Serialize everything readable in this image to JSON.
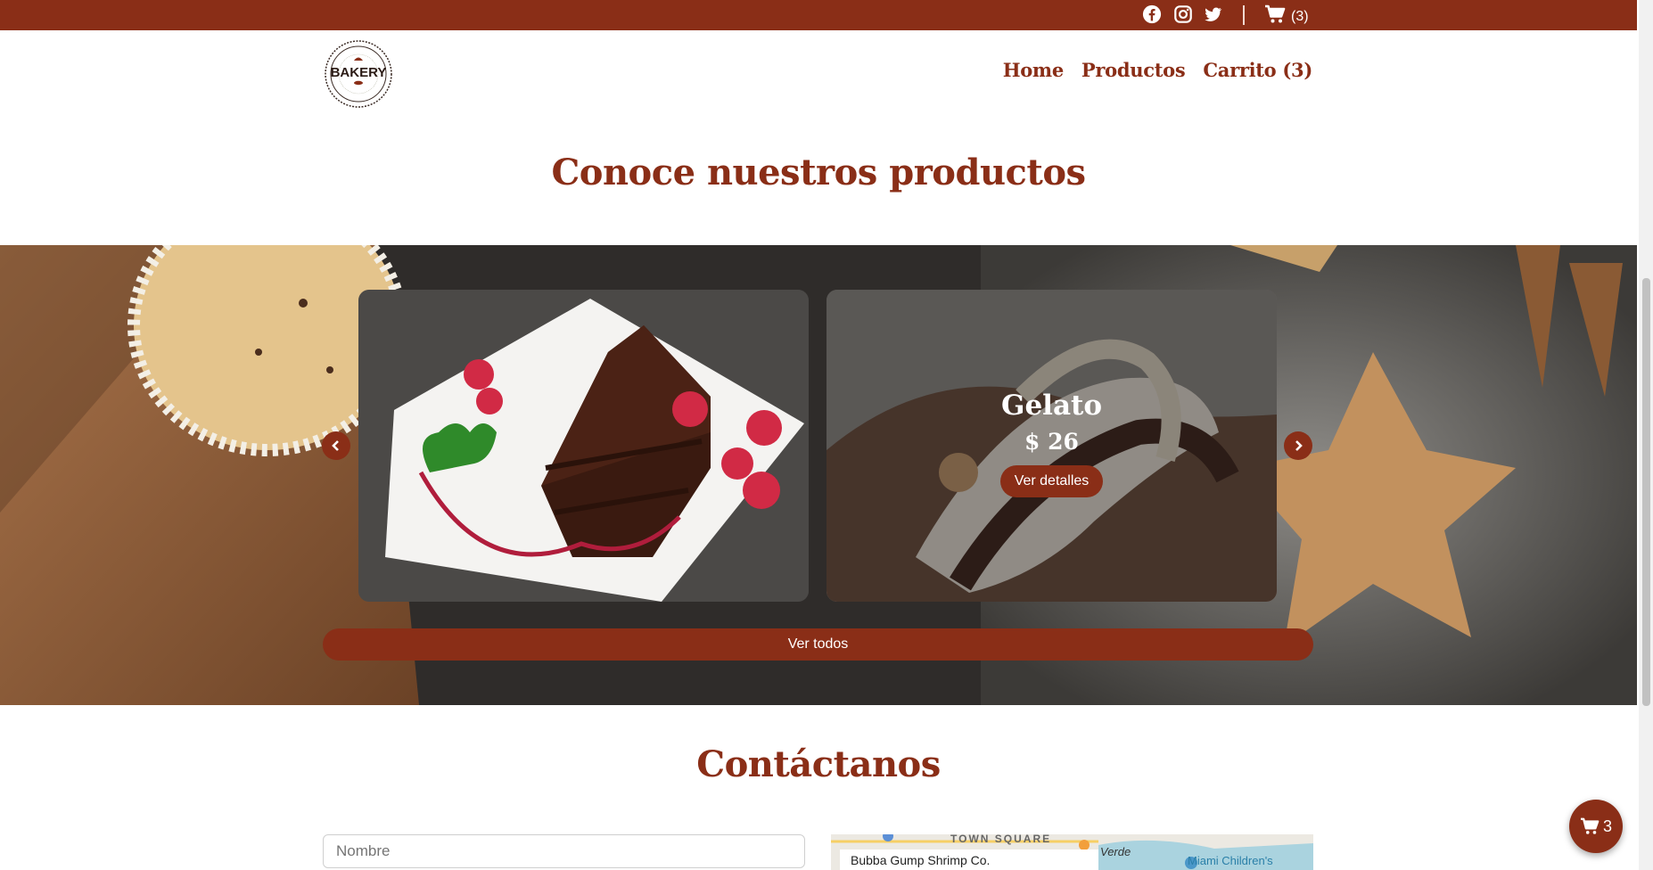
{
  "topbar": {
    "social_icons": [
      "facebook-icon",
      "instagram-icon",
      "twitter-icon"
    ],
    "cart_icon": "cart-icon",
    "cart_count": "(3)"
  },
  "header": {
    "logo_text": "BAKERY",
    "nav": [
      {
        "label": "Home"
      },
      {
        "label": "Productos"
      },
      {
        "label": "Carrito (3)"
      }
    ]
  },
  "products_section": {
    "title": "Conoce nuestros productos",
    "featured": {
      "name": "Gelato",
      "price": "$ 26",
      "details_button": "Ver detalles"
    },
    "view_all_button": "Ver todos"
  },
  "contact_section": {
    "title": "Contáctanos",
    "name_placeholder": "Nombre",
    "map": {
      "place_label": "Bubba Gump Shrimp Co.",
      "area_label": "TOWN SQUARE",
      "verde_label": "Verde",
      "hospital_label": "Miami Children's"
    }
  },
  "floating_cart": {
    "count": "3"
  },
  "colors": {
    "brand": "#8a2e17",
    "white": "#ffffff"
  }
}
